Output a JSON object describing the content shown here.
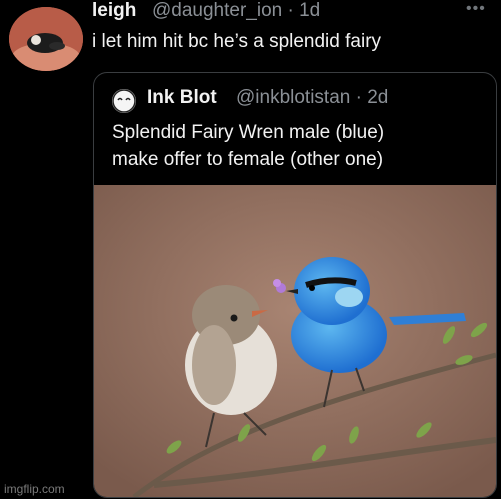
{
  "tweet": {
    "name": "leigh",
    "handle_time": "@daughter_ion · 1d",
    "text": "i let him hit bc he’s a splendid fairy",
    "more_icon": "more-horizontal-icon"
  },
  "quote": {
    "name": "Ink Blot",
    "handle_time": "@inkblotistan · 2d",
    "lines": [
      "Splendid Fairy Wren male (blue)",
      "make offer to female (other one)"
    ]
  },
  "watermark": "imgflip.com",
  "colors": {
    "background": "#000000",
    "text": "#f2f2f2",
    "muted": "#8b9096",
    "card_border": "#3a3d40"
  }
}
